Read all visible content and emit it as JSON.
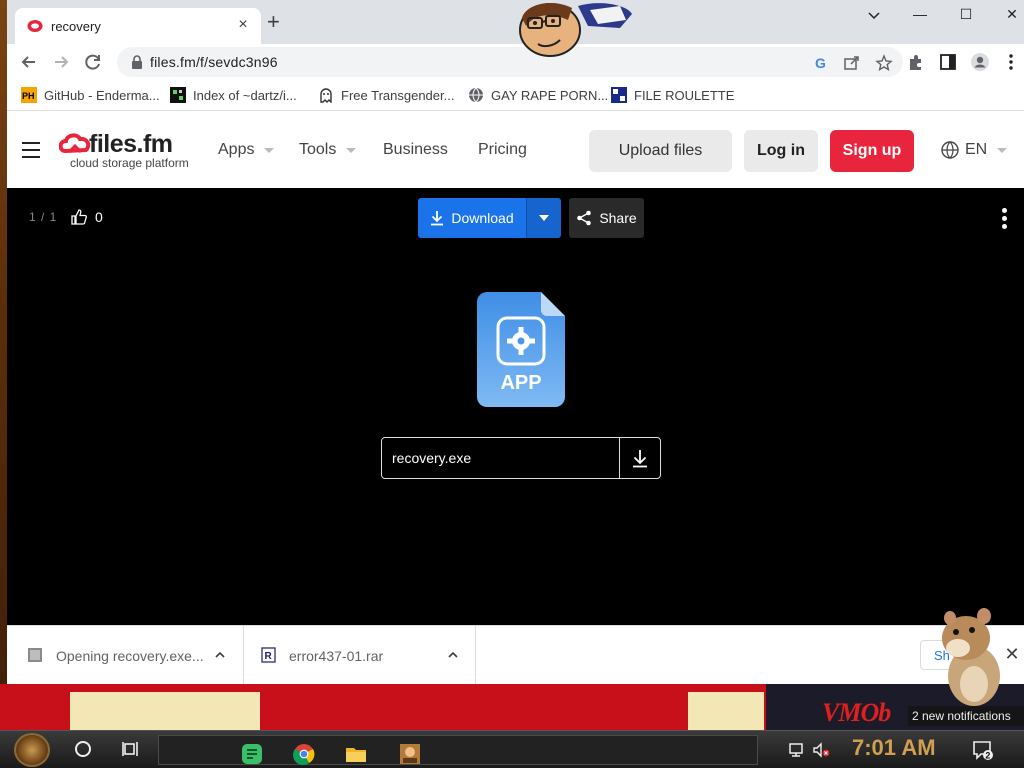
{
  "browser": {
    "tab_title": "recovery",
    "tab_close": "×",
    "new_tab": "+",
    "url": "files.fm/f/sevdc3n96",
    "window_controls": {
      "minimize": "—",
      "restore": "☐",
      "close": "✕"
    }
  },
  "bookmarks": [
    {
      "label": "GitHub - Enderma...",
      "icon": "ph-icon"
    },
    {
      "label": "Index of ~dartz/i...",
      "icon": "pixel-icon"
    },
    {
      "label": "Free Transgender...",
      "icon": "ghost-icon"
    },
    {
      "label": "GAY RAPE PORN...",
      "icon": "globe-icon"
    },
    {
      "label": "FILE ROULETTE",
      "icon": "roulette-icon"
    }
  ],
  "site": {
    "brand": "files.fm",
    "tagline": "cloud storage platform",
    "nav": [
      {
        "label": "Apps",
        "has_caret": true
      },
      {
        "label": "Tools",
        "has_caret": true
      },
      {
        "label": "Business",
        "has_caret": false
      },
      {
        "label": "Pricing",
        "has_caret": false
      }
    ],
    "upload_label": "Upload files",
    "login_label": "Log in",
    "signup_label": "Sign up",
    "language": "EN",
    "colors": {
      "signup": "#e8253c",
      "download": "#1a73e8",
      "brand_red": "#e8253c"
    }
  },
  "viewer": {
    "counter": "1 / 1",
    "likes": "0",
    "download_label": "Download",
    "share_label": "Share",
    "file_type_label": "APP",
    "file_name": "recovery.exe"
  },
  "downloads": [
    {
      "label": "Opening recovery.exe...",
      "icon": "file-generic-icon"
    },
    {
      "label": "error437-01.rar",
      "icon": "rar-icon"
    }
  ],
  "shelf_show_all": "Sh",
  "taskbar": {
    "clock": "7:01 AM",
    "notification_tooltip": "2 new notifications",
    "notification_count": "2"
  },
  "wallpaper_text": "VMOb"
}
